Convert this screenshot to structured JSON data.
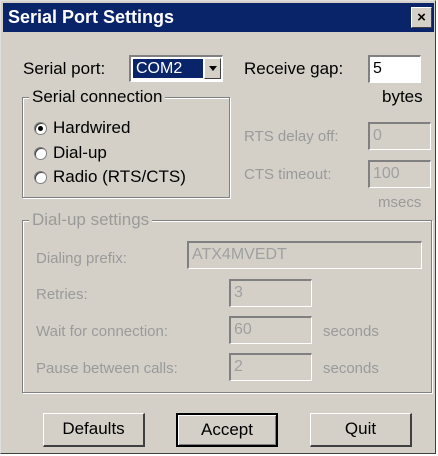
{
  "window": {
    "title": "Serial Port Settings",
    "close_glyph": "×"
  },
  "serial_port": {
    "label": "Serial port:",
    "selected": "COM2"
  },
  "receive_gap": {
    "label": "Receive gap:",
    "value": "5",
    "unit": "bytes"
  },
  "serial_connection": {
    "legend": "Serial connection",
    "options": [
      {
        "label": "Hardwired",
        "checked": true
      },
      {
        "label": "Dial-up",
        "checked": false
      },
      {
        "label": "Radio (RTS/CTS)",
        "checked": false
      }
    ]
  },
  "rts_delay_off": {
    "label": "RTS delay off:",
    "value": "0"
  },
  "cts_timeout": {
    "label": "CTS timeout:",
    "value": "100",
    "unit": "msecs"
  },
  "dialup_settings": {
    "legend": "Dial-up settings",
    "dialing_prefix": {
      "label": "Dialing prefix:",
      "value": "ATX4MVEDT"
    },
    "retries": {
      "label": "Retries:",
      "value": "3"
    },
    "wait_for_connection": {
      "label": "Wait for connection:",
      "value": "60",
      "unit": "seconds"
    },
    "pause_between_calls": {
      "label": "Pause between calls:",
      "value": "2",
      "unit": "seconds"
    }
  },
  "buttons": {
    "defaults": "Defaults",
    "accept": "Accept",
    "quit": "Quit"
  }
}
